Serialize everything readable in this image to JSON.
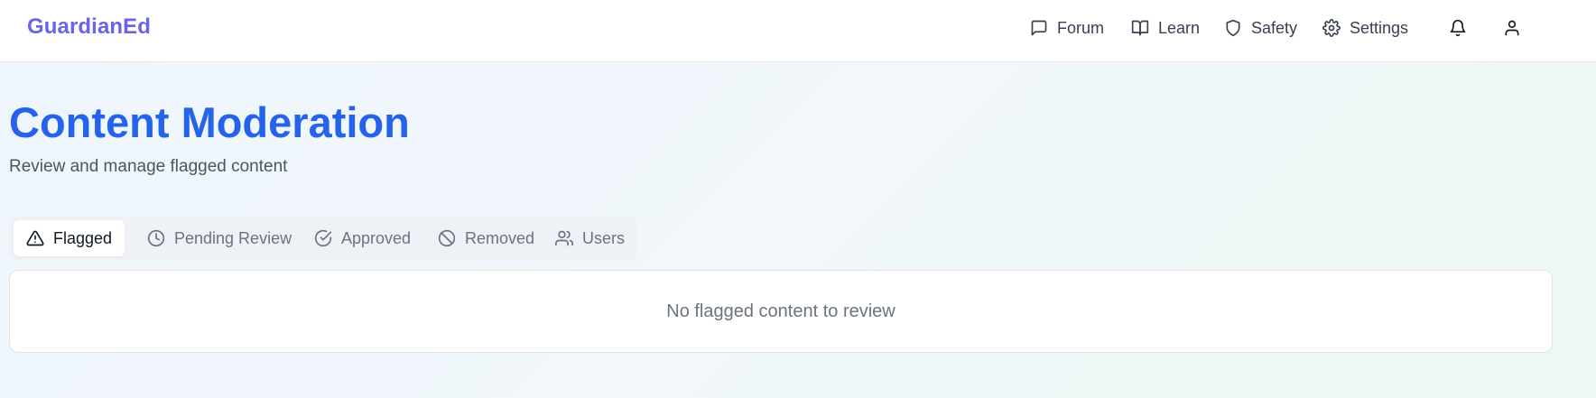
{
  "header": {
    "brand": "GuardianEd",
    "nav": [
      {
        "label": "Forum",
        "icon": "message-square-icon"
      },
      {
        "label": "Learn",
        "icon": "book-open-icon"
      },
      {
        "label": "Safety",
        "icon": "shield-icon"
      },
      {
        "label": "Settings",
        "icon": "gear-icon"
      }
    ],
    "actions": [
      {
        "icon": "bell-icon"
      },
      {
        "icon": "user-icon"
      }
    ]
  },
  "main": {
    "title": "Content Moderation",
    "subtitle": "Review and manage flagged content",
    "tabs": [
      {
        "label": "Flagged",
        "icon": "alert-triangle-icon",
        "active": true
      },
      {
        "label": "Pending Review",
        "icon": "clock-icon",
        "active": false
      },
      {
        "label": "Approved",
        "icon": "check-circle-icon",
        "active": false
      },
      {
        "label": "Removed",
        "icon": "ban-icon",
        "active": false
      },
      {
        "label": "Users",
        "icon": "users-icon",
        "active": false
      }
    ],
    "empty_state": "No flagged content to review"
  },
  "colors": {
    "brand": "#6b63e8",
    "title": "#2563eb",
    "text_muted": "#6b7280"
  }
}
